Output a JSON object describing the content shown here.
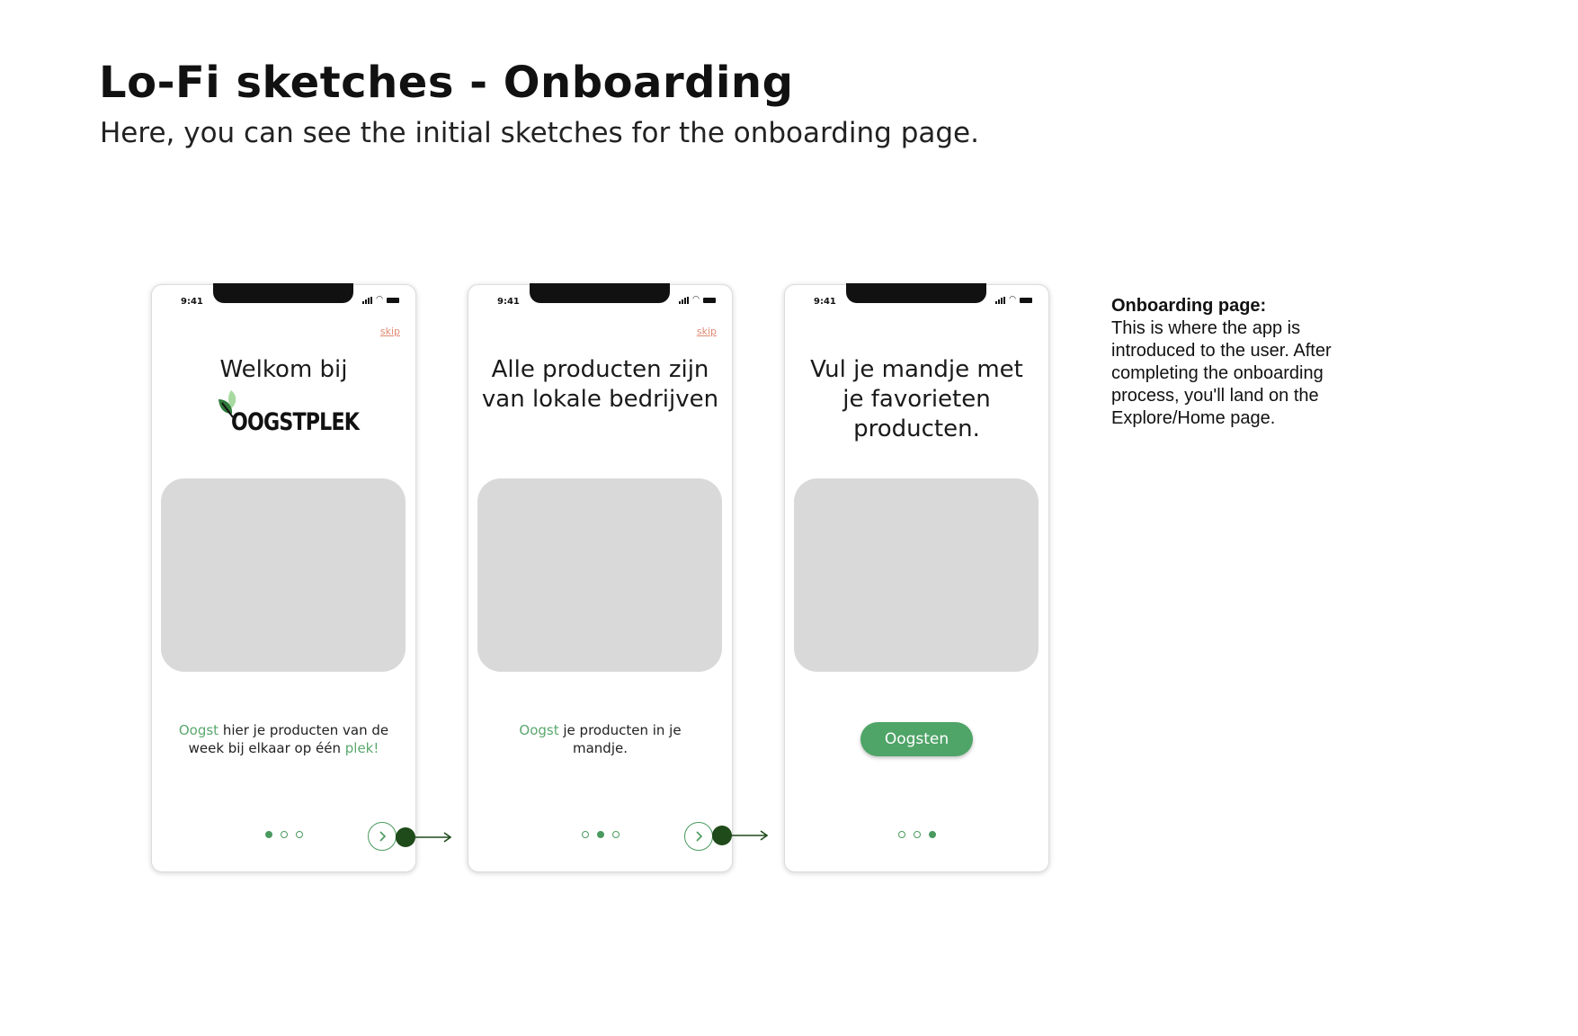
{
  "header": {
    "title": "Lo-Fi sketches - Onboarding",
    "subtitle": "Here, you can see the initial sketches for the onboarding page."
  },
  "screens": [
    {
      "status_time": "9:41",
      "skip_label": "skip",
      "title": "Welkom bij",
      "logo_text": "OOGSTPLEK",
      "body": {
        "highlight_1": "Oogst",
        "text_1": " hier je producten van de week bij elkaar op één ",
        "highlight_2": "plek!"
      },
      "active_dot": 1
    },
    {
      "status_time": "9:41",
      "skip_label": "skip",
      "title": "Alle producten zijn van lokale bedrijven",
      "body": {
        "highlight_1": "Oogst",
        "text_1": " je producten in je mandje."
      },
      "active_dot": 2
    },
    {
      "status_time": "9:41",
      "title": "Vul je mandje met je favorieten producten.",
      "button_label": "Oogsten",
      "active_dot": 3
    }
  ],
  "note": {
    "heading": "Onboarding page:",
    "body": "This is where the app is introduced to the user. After completing the onboarding process, you'll land on the Explore/Home page."
  },
  "colors": {
    "accent_green": "#4fa467",
    "dark_green": "#1f4a1a",
    "skip_orange": "#e08a72",
    "placeholder_gray": "#d9d9d9"
  },
  "icons": [
    "wifi-icon",
    "battery-icon",
    "signal-icon",
    "chevron-right-icon",
    "leaf-logo-icon",
    "arrow-right-icon"
  ]
}
